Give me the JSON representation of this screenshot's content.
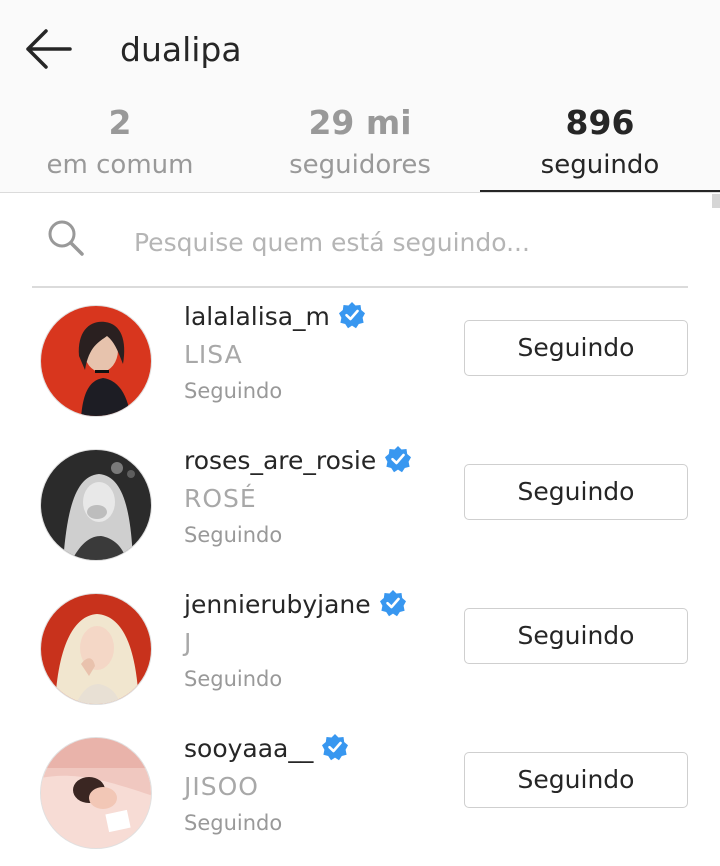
{
  "header": {
    "title": "dualipa",
    "back_icon": "arrow-left-icon",
    "tabs": [
      {
        "count": "2",
        "label": "em comum"
      },
      {
        "count": "29 mi",
        "label": "seguidores"
      },
      {
        "count": "896",
        "label": "seguindo"
      }
    ],
    "active_tab": 2
  },
  "search": {
    "placeholder": "Pesquise quem está seguindo...",
    "value": "",
    "icon": "search-icon"
  },
  "users": [
    {
      "username": "lalalalisa_m",
      "full_name": "LISA",
      "status": "Seguindo",
      "verified": true,
      "button_label": "Seguindo"
    },
    {
      "username": "roses_are_rosie",
      "full_name": "ROSÉ",
      "status": "Seguindo",
      "verified": true,
      "button_label": "Seguindo"
    },
    {
      "username": "jennierubyjane",
      "full_name": "J",
      "status": "Seguindo",
      "verified": true,
      "button_label": "Seguindo"
    },
    {
      "username": "sooyaaa__",
      "full_name": "JISOO",
      "status": "Seguindo",
      "verified": true,
      "button_label": "Seguindo"
    }
  ],
  "colors": {
    "verified_badge": "#3897f0",
    "text_primary": "#262626",
    "text_muted": "#999999",
    "header_bg": "#fafafa"
  }
}
